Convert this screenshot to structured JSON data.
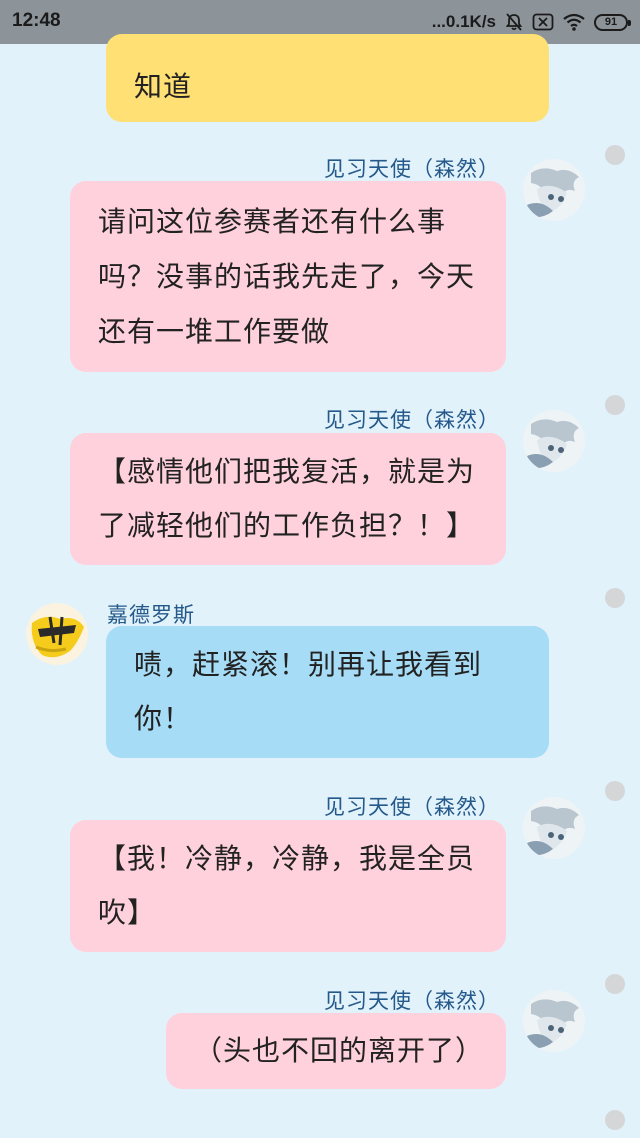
{
  "status_bar": {
    "time": "12:48",
    "network_speed": "...0.1K/s",
    "battery": "91",
    "icons": [
      "mute-bell-icon",
      "sim-card-off-icon",
      "wifi-icon",
      "battery-icon"
    ]
  },
  "colors": {
    "background": "#e1f2fb",
    "pink_bubble": "#ffd1dc",
    "blue_bubble": "#a7dcf6",
    "yellow_bubble": "#ffe074",
    "sender_name": "#24598a"
  },
  "messages": [
    {
      "sender": "",
      "text": "知道",
      "style": "yellow"
    },
    {
      "sender": "见习天使（森然）",
      "text": "请问这位参赛者还有什么事吗？没事的话我先走了，今天还有一堆工作要做",
      "style": "pink"
    },
    {
      "sender": "见习天使（森然）",
      "text": "【感情他们把我复活，就是为了减轻他们的工作负担？！】",
      "style": "pink"
    },
    {
      "sender": "嘉德罗斯",
      "text": "啧，赶紧滚！别再让我看到你！",
      "style": "blue"
    },
    {
      "sender": "见习天使（森然）",
      "text": "【我！冷静，冷静，我是全员吹】",
      "style": "pink"
    },
    {
      "sender": "见习天使（森然）",
      "text": "（头也不回的离开了）",
      "style": "pink"
    }
  ]
}
